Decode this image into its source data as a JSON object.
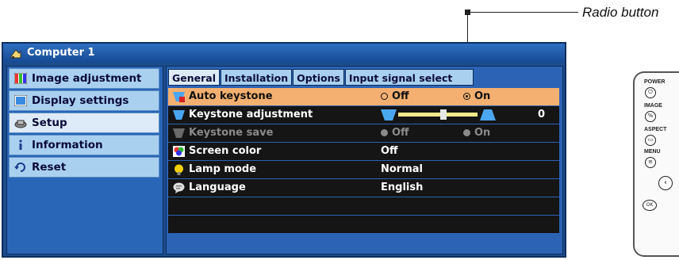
{
  "callout": {
    "label": "Radio button"
  },
  "window": {
    "title": "Computer 1"
  },
  "sidebar": {
    "items": [
      {
        "label": "Image adjustment",
        "icon": "image-adjustment-icon"
      },
      {
        "label": "Display settings",
        "icon": "display-settings-icon"
      },
      {
        "label": "Setup",
        "icon": "setup-icon",
        "active": true
      },
      {
        "label": "Information",
        "icon": "information-icon"
      },
      {
        "label": "Reset",
        "icon": "reset-icon"
      }
    ]
  },
  "tabs": [
    "General",
    "Installation",
    "Options",
    "Input signal select"
  ],
  "settings": [
    {
      "label": "Auto keystone",
      "off": "Off",
      "on": "On"
    },
    {
      "label": "Keystone adjustment",
      "value": "0"
    },
    {
      "label": "Keystone save",
      "off": "Off",
      "on": "On"
    },
    {
      "label": "Screen color",
      "value": "Off"
    },
    {
      "label": "Lamp mode",
      "value": "Normal"
    },
    {
      "label": "Language",
      "value": "English"
    }
  ],
  "remote": {
    "labels": [
      "POWER",
      "IMAGE",
      "ASPECT",
      "MENU"
    ],
    "ok_label": "OK"
  },
  "colors": {
    "selected_row": "#f3b070",
    "row_background": "#151515",
    "panel_blue": "#2c63b5",
    "sidebar_item": "#a9d0ef"
  }
}
